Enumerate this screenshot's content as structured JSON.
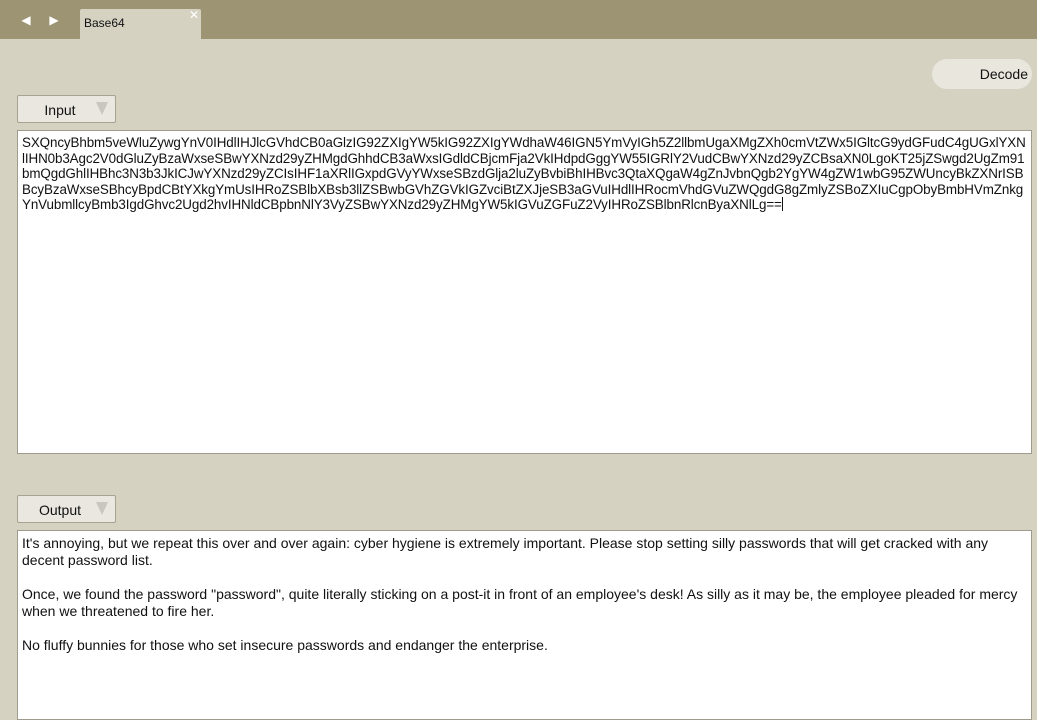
{
  "nav": {
    "back_glyph": "◀",
    "forward_glyph": "▶",
    "back_icon": "triangle-left-icon",
    "forward_icon": "triangle-right-icon"
  },
  "tabs": [
    {
      "label": "Base64",
      "close_glyph": "✕",
      "active": true
    }
  ],
  "toolbar": {
    "decode_label": "Decode"
  },
  "input": {
    "mode_label": "Input",
    "value": "SXQncyBhbm5veWluZywgYnV0IHdlIHJlcGVhdCB0aGlzIG92ZXIgYW5kIG92ZXIgYWdhaW46IGN5YmVyIGh5Z2llbmUgaXMgZXh0cmVtZWx5IGltcG9ydGFudC4gUGxlYXNlIHN0b3Agc2V0dGluZyBzaWxseSBwYXNzd29yZHMgdGhhdCB3aWxsIGdldCBjcmFja2VkIHdpdGggYW55IGRlY2VudCBwYXNzd29yZCBsaXN0LgoKT25jZSwgd2UgZm91bmQgdGhlIHBhc3N3b3JkICJwYXNzd29yZCIsIHF1aXRlIGxpdGVyYWxseSBzdGlja2luZyBvbiBhIHBvc3QtaXQgaW4gZnJvbnQgb2YgYW4gZW1wbG95ZWUncyBkZXNrISBBcyBzaWxseSBhcyBpdCBtYXkgYmUsIHRoZSBlbXBsb3llZSBwbGVhZGVkIGZvciBtZXJjeSB3aGVuIHdlIHRocmVhdGVuZWQgdG8gZmlyZSBoZXIuCgpObyBmbHVmZnkgYnVubmllcyBmb3IgdGhvc2Ugd2hvIHNldCBpbnNlY3VyZSBwYXNzd29yZHMgYW5kIGVuZGFuZ2VyIHRoZSBlbnRlcnByaXNlLg=="
  },
  "output": {
    "mode_label": "Output",
    "paragraphs": [
      "It's annoying, but we repeat this over and over again: cyber hygiene is extremely important. Please stop setting silly passwords that will get cracked with any decent password list.",
      "Once, we found the password \"password\", quite literally sticking on a post-it in front of an employee's desk! As silly as it may be, the employee pleaded for mercy when we threatened to fire her.",
      "No fluffy bunnies for those who set insecure passwords and endanger the enterprise."
    ]
  },
  "colors": {
    "titlebar": "#9c9472",
    "background": "#d6d2c2",
    "text_area": "#ffffff"
  }
}
